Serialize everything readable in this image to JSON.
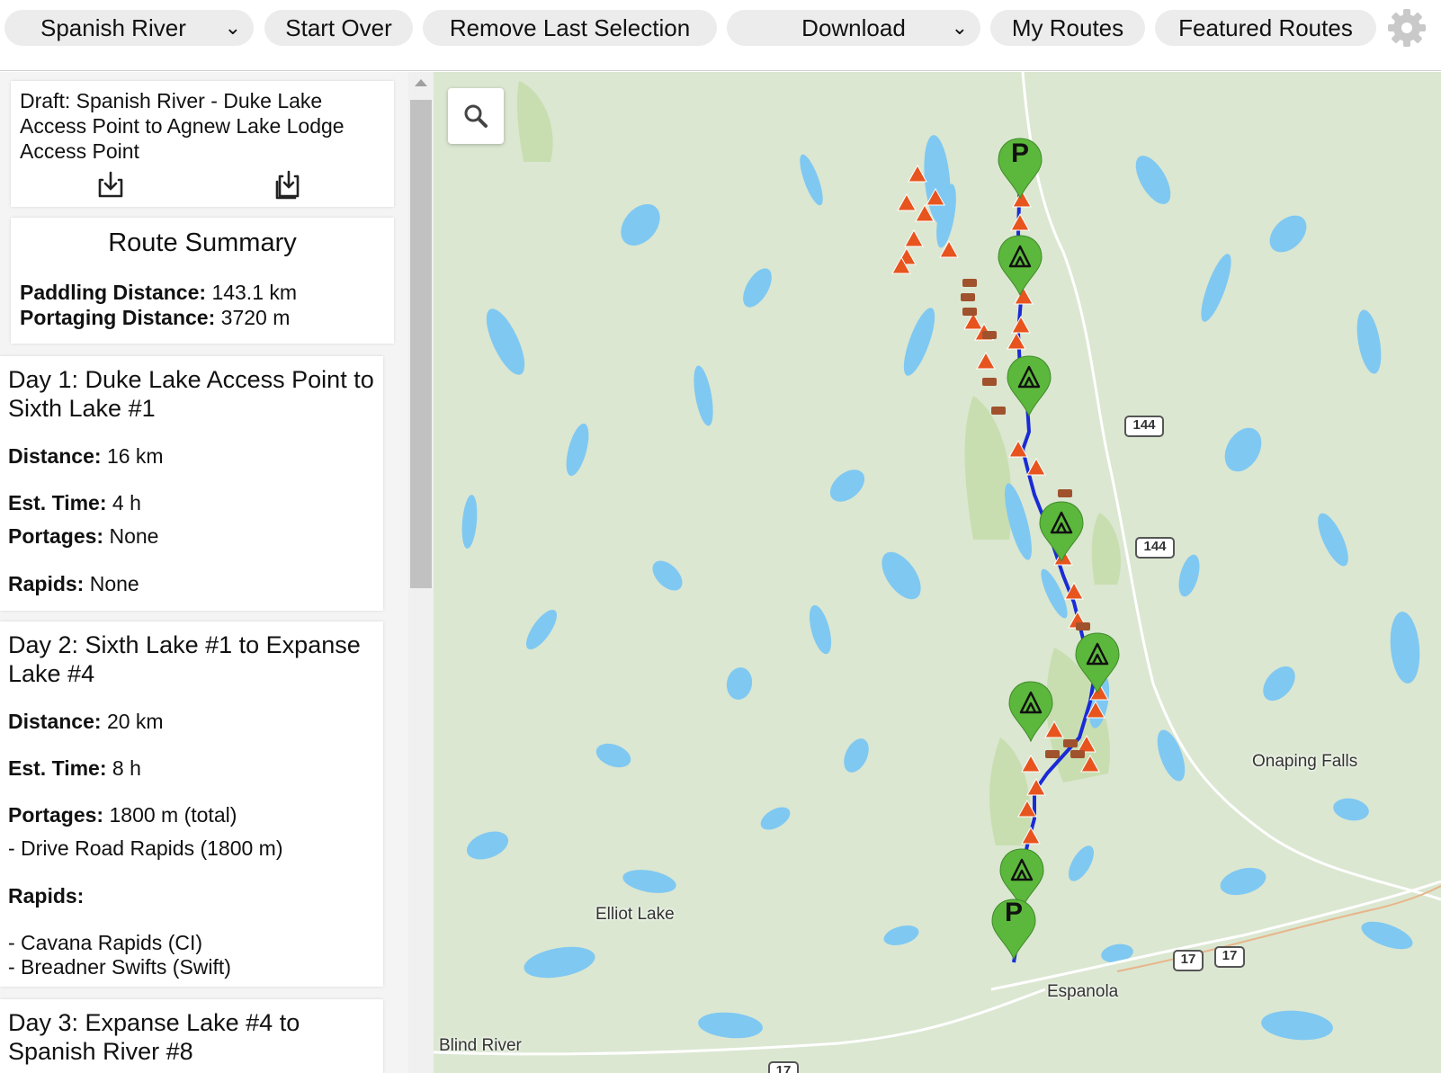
{
  "toolbar": {
    "river_select": "Spanish River",
    "start_over": "Start Over",
    "remove_last": "Remove Last Selection",
    "download": "Download",
    "my_routes": "My Routes",
    "featured_routes": "Featured Routes"
  },
  "draft": {
    "title": "Draft: Spanish River - Duke Lake Access Point to Agnew Lake Lodge Access Point"
  },
  "summary": {
    "title": "Route Summary",
    "paddling_label": "Paddling Distance:",
    "paddling_value": "143.1 km",
    "portaging_label": "Portaging Distance:",
    "portaging_value": "3720 m"
  },
  "days": [
    {
      "title": "Day 1: Duke Lake Access Point to Sixth Lake #1",
      "distance_label": "Distance:",
      "distance": "16 km",
      "time_label": "Est. Time:",
      "time": "4 h",
      "portages_label": "Portages:",
      "portages": "None",
      "rapids_label": "Rapids:",
      "rapids": "None"
    },
    {
      "title": "Day 2: Sixth Lake #1 to Expanse Lake #4",
      "distance_label": "Distance:",
      "distance": "20 km",
      "time_label": "Est. Time:",
      "time": "8 h",
      "portages_label": "Portages:",
      "portages": "1800 m (total)",
      "portage_items": [
        "- Drive Road Rapids (1800 m)"
      ],
      "rapids_label": "Rapids:",
      "rapids": "",
      "rapid_items": [
        "- Cavana Rapids (CI)",
        "- Breadner Swifts (Swift)"
      ]
    },
    {
      "title": "Day 3: Expanse Lake #4 to Spanish River #8"
    }
  ],
  "map": {
    "places": {
      "onaping": "Onaping Falls",
      "elliot": "Elliot Lake",
      "espanola": "Espanola",
      "blind": "Blind River"
    },
    "shields": {
      "h144a": "144",
      "h144b": "144",
      "h17a": "17",
      "h17b": "17",
      "h17c": "17"
    },
    "access_marker": "P",
    "colors": {
      "land": "#dbe7d1",
      "water": "#7fc8f2",
      "park": "#c8deb0",
      "route": "#1a2bd6",
      "campsite": "#e8541e",
      "marker": "#5cb83c"
    }
  }
}
